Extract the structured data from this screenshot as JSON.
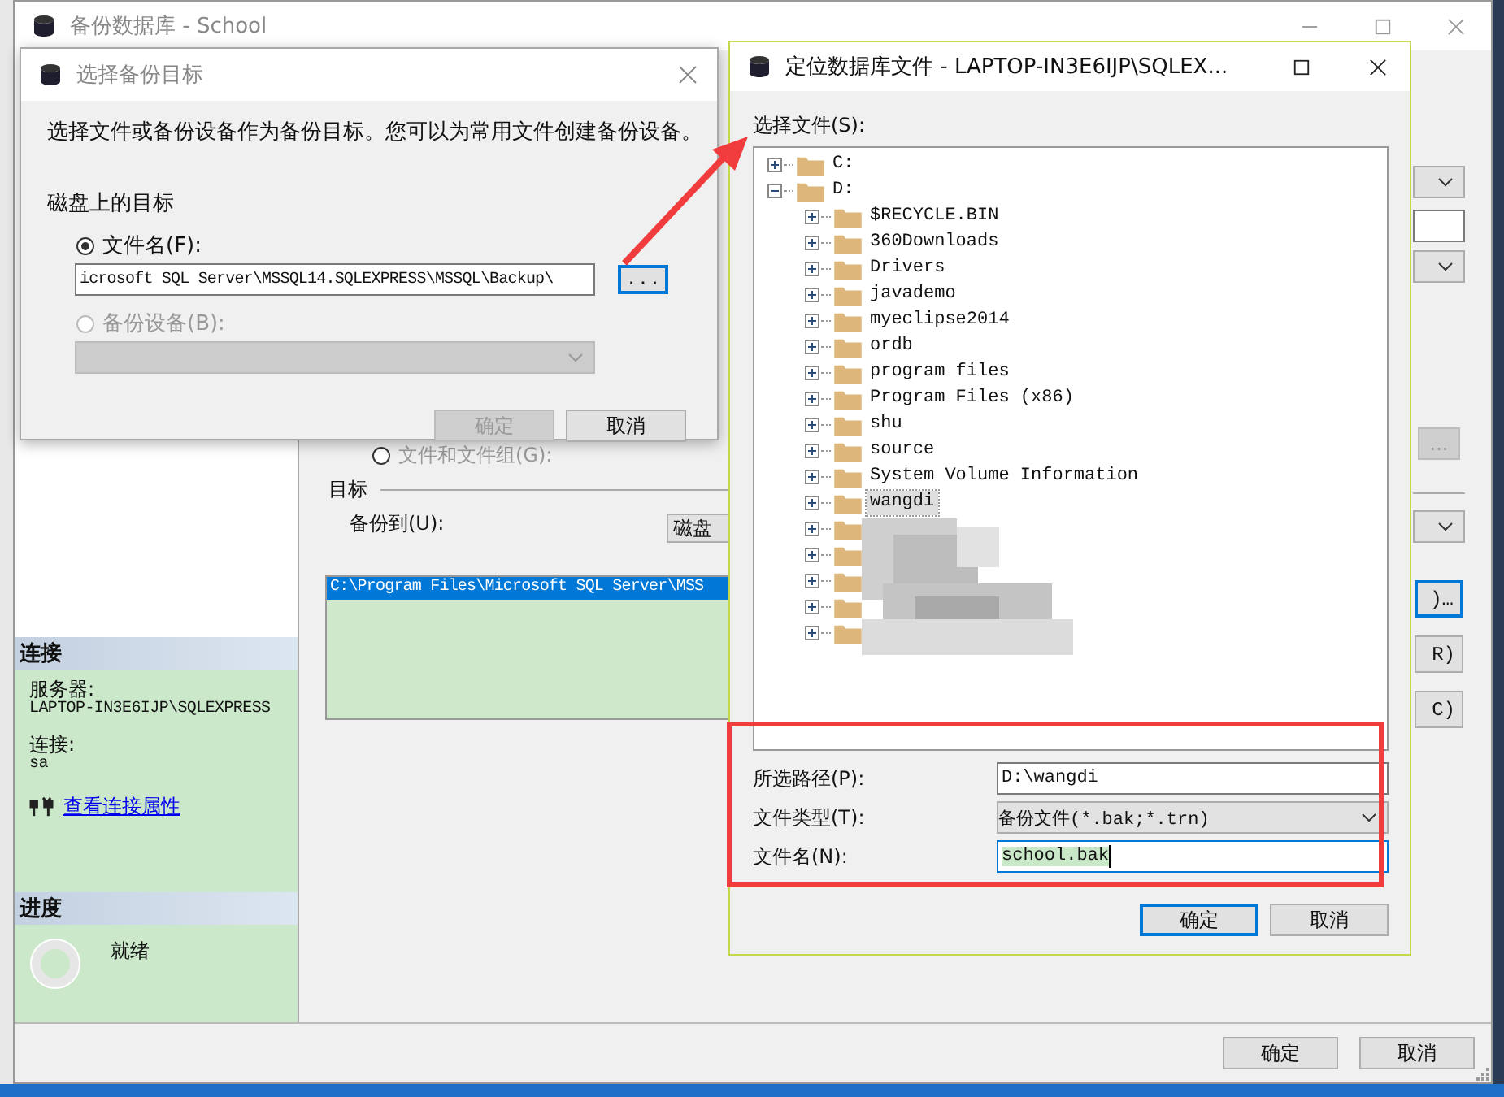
{
  "main_window": {
    "title": "备份数据库 - School",
    "connection": {
      "heading": "连接",
      "server_label": "服务器:",
      "server": "LAPTOP-IN3E6IJP\\SQLEXPRESS",
      "login_label": "连接:",
      "login": "sa",
      "link": "查看连接属性"
    },
    "progress": {
      "heading": "进度",
      "status": "就绪"
    },
    "file_group_option": {
      "label": "文件和文件组(G):",
      "selected": false
    },
    "destination": {
      "heading": "目标",
      "backup_to_label": "备份到(U):",
      "backup_to": "磁盘",
      "paths": [
        {
          "text": "C:\\Program Files\\Microsoft SQL Server\\MSS",
          "selected": true
        }
      ]
    },
    "browse_button": {
      "label": "...",
      "disabled": true
    },
    "side_buttons": [
      {
        "label": ")…",
        "focused": true
      },
      {
        "label": "R)",
        "focused": false
      },
      {
        "label": "C)",
        "focused": false
      }
    ],
    "buttons": [
      "确定",
      "取消"
    ]
  },
  "select_dialog": {
    "title": "选择备份目标",
    "description": "选择文件或备份设备作为备份目标。您可以为常用文件创建备份设备。",
    "group_label": "磁盘上的目标",
    "options": [
      {
        "label": "文件名(F):",
        "selected": true,
        "disabled": false
      },
      {
        "label": "备份设备(B):",
        "selected": false,
        "disabled": true
      }
    ],
    "file_name": "icrosoft SQL Server\\MSSQL14.SQLEXPRESS\\MSSQL\\Backup\\",
    "browse_button": "...",
    "buttons": [
      {
        "label": "确定",
        "disabled": true
      },
      {
        "label": "取消",
        "disabled": false
      }
    ]
  },
  "locate_dialog": {
    "title": "定位数据库文件 - LAPTOP-IN3E6IJP\\SQLEX...",
    "tree_label": "选择文件(S):",
    "tree": [
      {
        "label": "C:",
        "expanded": false,
        "selected": false
      },
      {
        "label": "D:",
        "expanded": true,
        "selected": false,
        "children": [
          {
            "label": "$RECYCLE.BIN",
            "expanded": false,
            "selected": false
          },
          {
            "label": "360Downloads",
            "expanded": false,
            "selected": false
          },
          {
            "label": "Drivers",
            "expanded": false,
            "selected": false
          },
          {
            "label": "javademo",
            "expanded": false,
            "selected": false
          },
          {
            "label": "myeclipse2014",
            "expanded": false,
            "selected": false
          },
          {
            "label": "ordb",
            "expanded": false,
            "selected": false
          },
          {
            "label": "program files",
            "expanded": false,
            "selected": false
          },
          {
            "label": "Program Files (x86)",
            "expanded": false,
            "selected": false
          },
          {
            "label": "shu",
            "expanded": false,
            "selected": false
          },
          {
            "label": "source",
            "expanded": false,
            "selected": false
          },
          {
            "label": "System Volume Information",
            "expanded": false,
            "selected": false
          },
          {
            "label": "wangdi",
            "expanded": false,
            "selected": true
          },
          {
            "kind": "redacted",
            "expanded": false
          },
          {
            "kind": "redacted",
            "expanded": false
          },
          {
            "kind": "redacted",
            "expanded": false
          },
          {
            "kind": "redacted",
            "expanded": false
          },
          {
            "kind": "redacted",
            "expanded": false
          }
        ]
      }
    ],
    "path_label": "所选路径(P):",
    "path": "D:\\wangdi",
    "type_label": "文件类型(T):",
    "type": "备份文件(*.bak;*.trn)",
    "name_label": "文件名(N):",
    "name": "school.bak",
    "buttons": [
      {
        "label": "确定",
        "default": true
      },
      {
        "label": "取消",
        "default": false
      }
    ]
  }
}
